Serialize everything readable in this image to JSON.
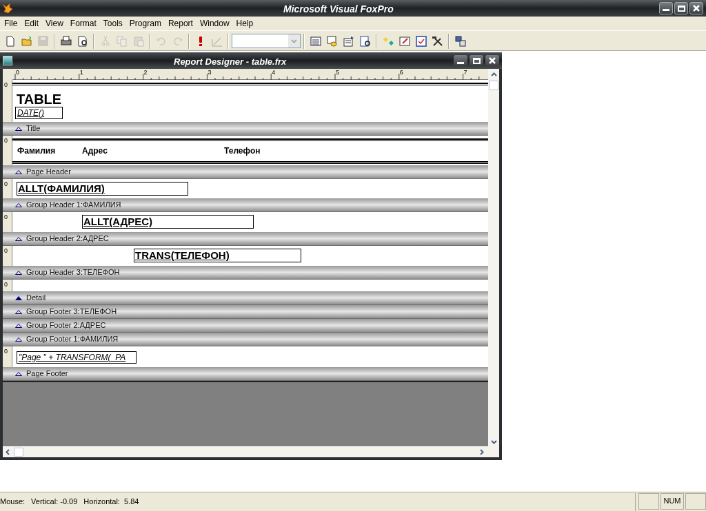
{
  "app": {
    "title": "Microsoft Visual FoxPro"
  },
  "menu": [
    "File",
    "Edit",
    "View",
    "Format",
    "Tools",
    "Program",
    "Report",
    "Window",
    "Help"
  ],
  "toolbar": [
    {
      "kind": "new",
      "disabled": false
    },
    {
      "kind": "open",
      "disabled": false
    },
    {
      "kind": "save",
      "disabled": true
    },
    {
      "kind": "sep"
    },
    {
      "kind": "print",
      "disabled": false
    },
    {
      "kind": "preview",
      "disabled": false
    },
    {
      "kind": "sep"
    },
    {
      "kind": "cut",
      "disabled": true
    },
    {
      "kind": "copy",
      "disabled": true
    },
    {
      "kind": "paste",
      "disabled": true
    },
    {
      "kind": "sep"
    },
    {
      "kind": "undo",
      "disabled": true
    },
    {
      "kind": "redo",
      "disabled": true
    },
    {
      "kind": "sep"
    },
    {
      "kind": "run",
      "disabled": false
    },
    {
      "kind": "modify",
      "disabled": true
    },
    {
      "kind": "sep"
    },
    {
      "kind": "combo"
    },
    {
      "kind": "sep"
    },
    {
      "kind": "window",
      "disabled": false
    },
    {
      "kind": "data",
      "disabled": false
    },
    {
      "kind": "props",
      "disabled": false
    },
    {
      "kind": "code",
      "disabled": false
    },
    {
      "kind": "sep"
    },
    {
      "kind": "tools",
      "disabled": false
    },
    {
      "kind": "form",
      "disabled": false
    },
    {
      "kind": "report",
      "disabled": false
    },
    {
      "kind": "hammer",
      "disabled": false
    },
    {
      "kind": "sep"
    },
    {
      "kind": "manager",
      "disabled": false
    }
  ],
  "report_window": {
    "title": "Report Designer - table.frx",
    "ruler_marks": [
      "0",
      "1",
      "2",
      "3",
      "4",
      "5",
      "6",
      "7"
    ],
    "bands": [
      {
        "label": "Title",
        "selected": false,
        "ruler_label": "0",
        "items": [
          {
            "kind": "heading",
            "text": "TABLE"
          },
          {
            "kind": "italic-field",
            "text": "DATE()"
          }
        ]
      },
      {
        "label": "Page Header",
        "selected": false,
        "ruler_label": "0",
        "items": [
          {
            "kind": "column-label",
            "text": "Фамилия"
          },
          {
            "kind": "column-label",
            "text": "Адрес"
          },
          {
            "kind": "column-label",
            "text": "Телефон"
          }
        ]
      },
      {
        "label": "Group Header 1:ФАМИЛИЯ",
        "selected": false,
        "ruler_label": "0",
        "items": [
          {
            "kind": "bold-field",
            "text": "ALLT(ФАМИЛИЯ)"
          }
        ]
      },
      {
        "label": "Group Header 2:АДРЕС",
        "selected": false,
        "ruler_label": "0",
        "items": [
          {
            "kind": "bold-field",
            "text": "ALLT(АДРЕС)"
          }
        ]
      },
      {
        "label": "Group Header 3:ТЕЛЕФОН",
        "selected": false,
        "ruler_label": "0",
        "items": [
          {
            "kind": "bold-field",
            "text": "TRANS(ТЕЛЕФОН)"
          }
        ]
      },
      {
        "label": "Detail",
        "selected": true,
        "ruler_label": "0"
      },
      {
        "label": "Group Footer 3:ТЕЛЕФОН",
        "selected": false
      },
      {
        "label": "Group Footer 2:АДРЕС",
        "selected": false
      },
      {
        "label": "Group Footer 1:ФАМИЛИЯ",
        "selected": false
      },
      {
        "label": "Page Footer",
        "selected": false,
        "ruler_label": "0",
        "items": [
          {
            "kind": "italic-field",
            "text": "\"Page \" + TRANSFORM(_PA"
          }
        ]
      }
    ]
  },
  "status_bar": {
    "texts": [
      "Mouse:",
      "Vertical: -0.09",
      "Horizontal:  5.84"
    ],
    "panes": [
      "NUM"
    ]
  }
}
